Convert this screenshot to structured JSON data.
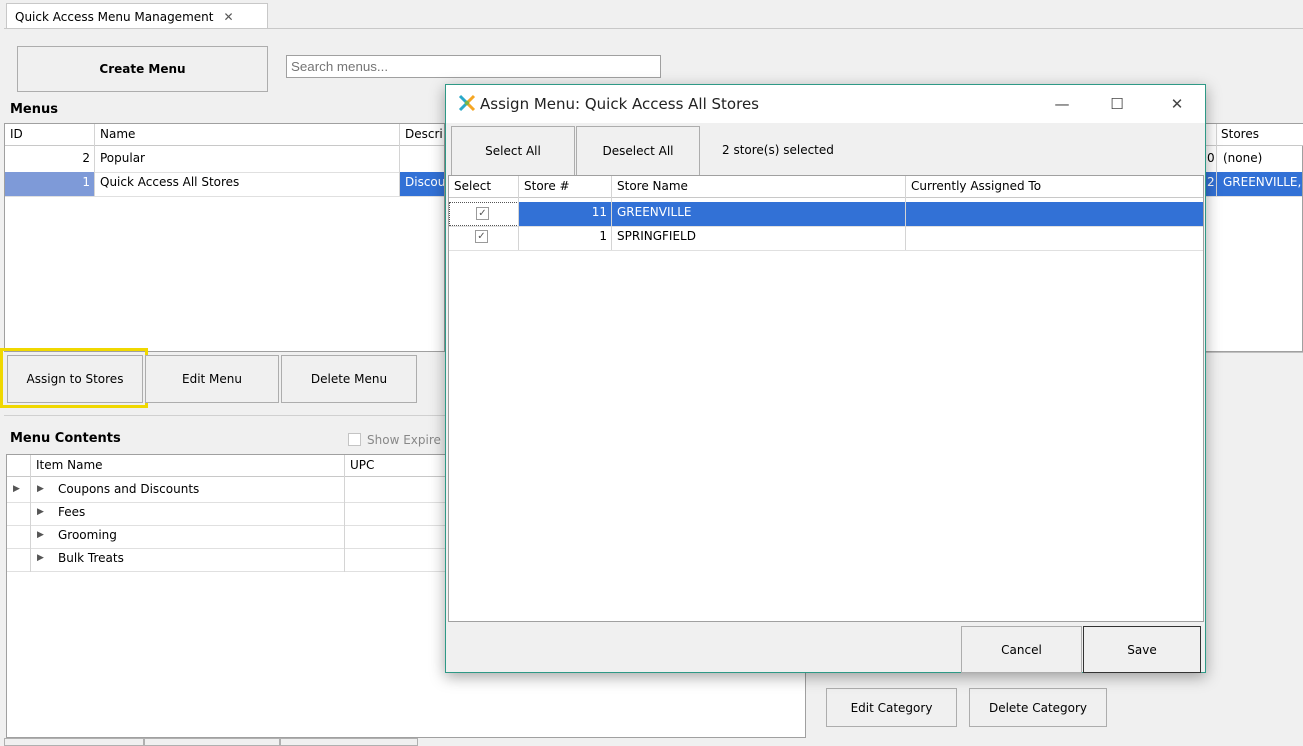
{
  "tab": {
    "title": "Quick Access Menu Management",
    "close": "✕"
  },
  "toolbar": {
    "create_menu": "Create Menu",
    "search_placeholder": "Search menus..."
  },
  "menus": {
    "title": "Menus",
    "columns": {
      "id": "ID",
      "name": "Name",
      "description": "Descri",
      "stores": "Stores"
    },
    "rows": [
      {
        "id": "2",
        "name": "Popular",
        "description": "",
        "count": "0",
        "stores": "(none)"
      },
      {
        "id": "1",
        "name": "Quick Access All Stores",
        "description": "Discou",
        "count": "2",
        "stores": "GREENVILLE,"
      }
    ],
    "buttons": {
      "assign": "Assign to Stores",
      "edit": "Edit Menu",
      "delete": "Delete Menu"
    }
  },
  "contents": {
    "title": "Menu Contents",
    "show_expired": "Show Expire",
    "columns": {
      "item_name": "Item Name",
      "upc": "UPC"
    },
    "rows": [
      "Coupons and Discounts",
      "Fees",
      "Grooming",
      "Bulk Treats"
    ],
    "buttons": {
      "edit_category": "Edit Category",
      "delete_category": "Delete Category"
    }
  },
  "dialog": {
    "title": "Assign Menu: Quick Access All Stores",
    "select_all": "Select All",
    "deselect_all": "Deselect All",
    "selected_count": "2 store(s) selected",
    "columns": {
      "select": "Select",
      "store_no": "Store #",
      "store_name": "Store Name",
      "assigned": "Currently Assigned To"
    },
    "rows": [
      {
        "checked": true,
        "store_no": "11",
        "store_name": "GREENVILLE",
        "assigned": ""
      },
      {
        "checked": true,
        "store_no": "1",
        "store_name": "SPRINGFIELD",
        "assigned": ""
      }
    ],
    "cancel": "Cancel",
    "save": "Save",
    "controls": {
      "minimize": "—",
      "maximize": "☐",
      "close": "✕"
    }
  },
  "colors": {
    "selection": "#3271d6",
    "highlight": "#f0d800",
    "dialog_border": "#2e9986"
  }
}
